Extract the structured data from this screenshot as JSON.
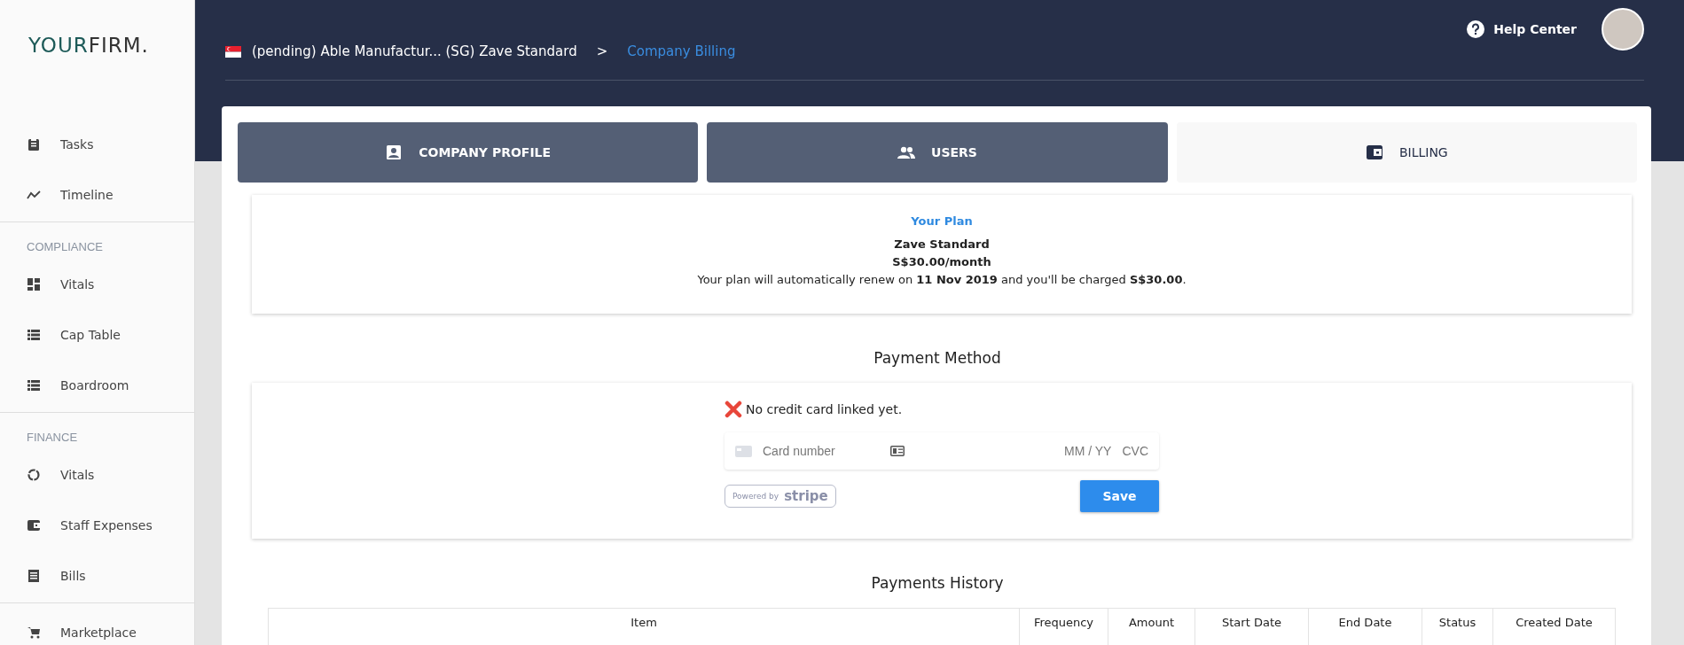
{
  "logo": {
    "part_1": "YOUR",
    "part_2": "FIRM."
  },
  "sidebar": {
    "sections": [
      {
        "items": [
          {
            "label": "Tasks"
          },
          {
            "label": "Timeline"
          }
        ]
      },
      {
        "title": "COMPLIANCE",
        "items": [
          {
            "label": "Vitals"
          },
          {
            "label": "Cap Table"
          },
          {
            "label": "Boardroom"
          }
        ]
      },
      {
        "title": "FINANCE",
        "items": [
          {
            "label": "Vitals"
          },
          {
            "label": "Staff Expenses"
          },
          {
            "label": "Bills"
          }
        ]
      },
      {
        "items": [
          {
            "label": "Marketplace"
          }
        ]
      }
    ]
  },
  "header": {
    "breadcrumb": [
      {
        "label": "(pending) Able Manufactur... (SG) Zave Standard",
        "current": false
      },
      {
        "label": "Company Billing",
        "current": true
      }
    ],
    "separator": ">",
    "help": "Help Center"
  },
  "tabs": [
    {
      "label": "COMPANY PROFILE",
      "selected": false
    },
    {
      "label": "USERS",
      "selected": false
    },
    {
      "label": "BILLING",
      "selected": true
    }
  ],
  "plan": {
    "title": "Your Plan",
    "name": "Zave Standard",
    "price": "S$30.00/month",
    "renewal": "Your plan will automatically renew on **11 Nov 2019** and you'll be charged **S$30.00**."
  },
  "payment_method": {
    "title": "Payment Method",
    "status": "No credit card linked yet.",
    "card_placeholder": "Card number",
    "expiry_placeholder": "MM / YY",
    "cvc_placeholder": "CVC",
    "powered_by": "Powered by",
    "stripe": "stripe",
    "save": "Save"
  },
  "payments_history": {
    "title": "Payments History",
    "columns": [
      "Item",
      "Frequency",
      "Amount",
      "Start Date",
      "End Date",
      "Status",
      "Created Date"
    ]
  }
}
